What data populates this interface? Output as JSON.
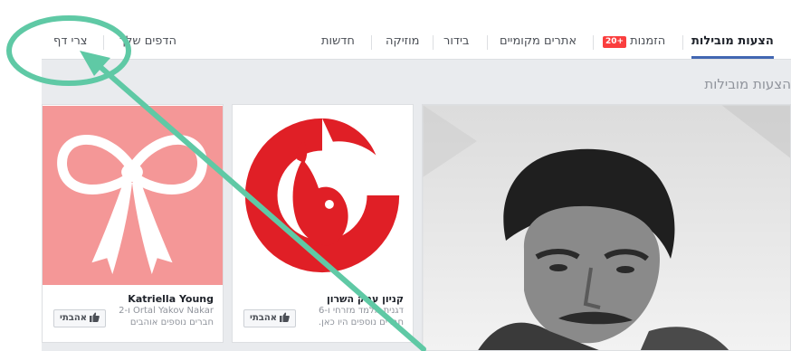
{
  "nav": {
    "tabs": [
      {
        "label": "הצעות מובילות",
        "active": true
      },
      {
        "label": "הזמנות",
        "badge": "+20"
      },
      {
        "label": "אתרים מקומיים"
      },
      {
        "label": "בידור"
      },
      {
        "label": "מוזיקה"
      },
      {
        "label": "חדשות"
      }
    ],
    "your_pages": "הדפים שלך",
    "create_page": "צרי דף"
  },
  "section_title": "הצעות מובילות",
  "cards": [
    {
      "name": "קניון עמק השרון",
      "line1": "דגנית מלמד מזרחי ו-6",
      "line2": "חברים נוספים היו כאן.",
      "like_label": "אהבתי"
    },
    {
      "name": "Katriella Young",
      "line1": "Ortal Yakov Nakar ו-2",
      "line2": "חברים נוספים אוהבים",
      "like_label": "אהבתי"
    }
  ],
  "colors": {
    "accent": "#4267b2",
    "badge": "#fa3e3e",
    "annotation": "#5fc9a5",
    "bow_bg": "#f49797",
    "logo_red": "#e01f26"
  }
}
